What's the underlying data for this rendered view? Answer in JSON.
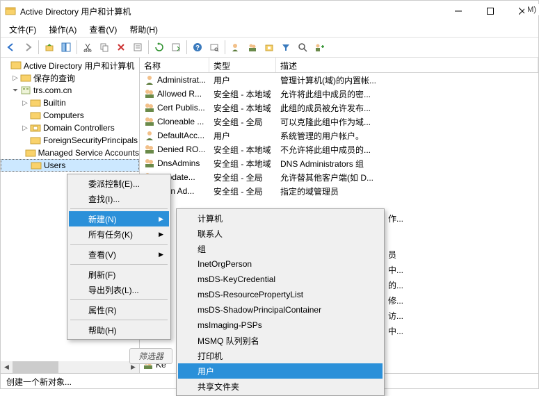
{
  "window": {
    "title": "Active Directory 用户和计算机",
    "extra_right": "M)"
  },
  "menu": {
    "file": "文件(F)",
    "action": "操作(A)",
    "view": "查看(V)",
    "help": "帮助(H)"
  },
  "tree": {
    "root": "Active Directory 用户和计算机",
    "saved_queries": "保存的查询",
    "domain": "trs.com.cn",
    "builtin": "Builtin",
    "computers": "Computers",
    "dcs": "Domain Controllers",
    "fsp": "ForeignSecurityPrincipals",
    "msa": "Managed Service Accounts",
    "users": "Users"
  },
  "columns": {
    "name": "名称",
    "type": "类型",
    "desc": "描述"
  },
  "rows": [
    {
      "name": "Administrat...",
      "type": "用户",
      "desc": "管理计算机(域)的内置帐...",
      "icon": "user"
    },
    {
      "name": "Allowed R...",
      "type": "安全组 - 本地域",
      "desc": "允许将此组中成员的密...",
      "icon": "group"
    },
    {
      "name": "Cert Publis...",
      "type": "安全组 - 本地域",
      "desc": "此组的成员被允许发布...",
      "icon": "group"
    },
    {
      "name": "Cloneable ...",
      "type": "安全组 - 全局",
      "desc": "可以克隆此组中作为域...",
      "icon": "group"
    },
    {
      "name": "DefaultAcc...",
      "type": "用户",
      "desc": "系统管理的用户帐户。",
      "icon": "user"
    },
    {
      "name": "Denied RO...",
      "type": "安全组 - 本地域",
      "desc": "不允许将此组中成员的...",
      "icon": "group"
    },
    {
      "name": "DnsAdmins",
      "type": "安全组 - 本地域",
      "desc": "DNS Administrators 组",
      "icon": "group"
    },
    {
      "name": "sUpdate...",
      "type": "安全组 - 全局",
      "desc": "允许替其他客户端(如 D...",
      "icon": "group"
    },
    {
      "name": "main Ad...",
      "type": "安全组 - 全局",
      "desc": "指定的域管理员",
      "icon": "group"
    }
  ],
  "partial_rows": [
    {
      "desc": "作...",
      "icon": "group"
    },
    {
      "desc": "员",
      "icon": "group"
    },
    {
      "desc": "中...",
      "icon": "group"
    },
    {
      "desc": "的...",
      "icon": "group"
    },
    {
      "desc": "修...",
      "icon": ""
    },
    {
      "desc": "访...",
      "icon": ""
    },
    {
      "desc": "中...",
      "icon": ""
    }
  ],
  "bottom_row": {
    "name": "Ke",
    "icon": "group"
  },
  "context_menu": {
    "delegate": "委派控制(E)...",
    "find": "查找(I)...",
    "new": "新建(N)",
    "all_tasks": "所有任务(K)",
    "view": "查看(V)",
    "refresh": "刷新(F)",
    "export_list": "导出列表(L)...",
    "properties": "属性(R)",
    "help": "帮助(H)"
  },
  "submenu": {
    "computer": "计算机",
    "contact": "联系人",
    "group": "组",
    "inetorg": "InetOrgPerson",
    "mskeycred": "msDS-KeyCredential",
    "msresprop": "msDS-ResourcePropertyList",
    "msshadow": "msDS-ShadowPrincipalContainer",
    "msimaging": "msImaging-PSPs",
    "msmq": "MSMQ 队列别名",
    "printer": "打印机",
    "user": "用户",
    "shared_folder": "共享文件夹"
  },
  "statusbar": "创建一个新对象...",
  "filter_chip": "筛选器"
}
